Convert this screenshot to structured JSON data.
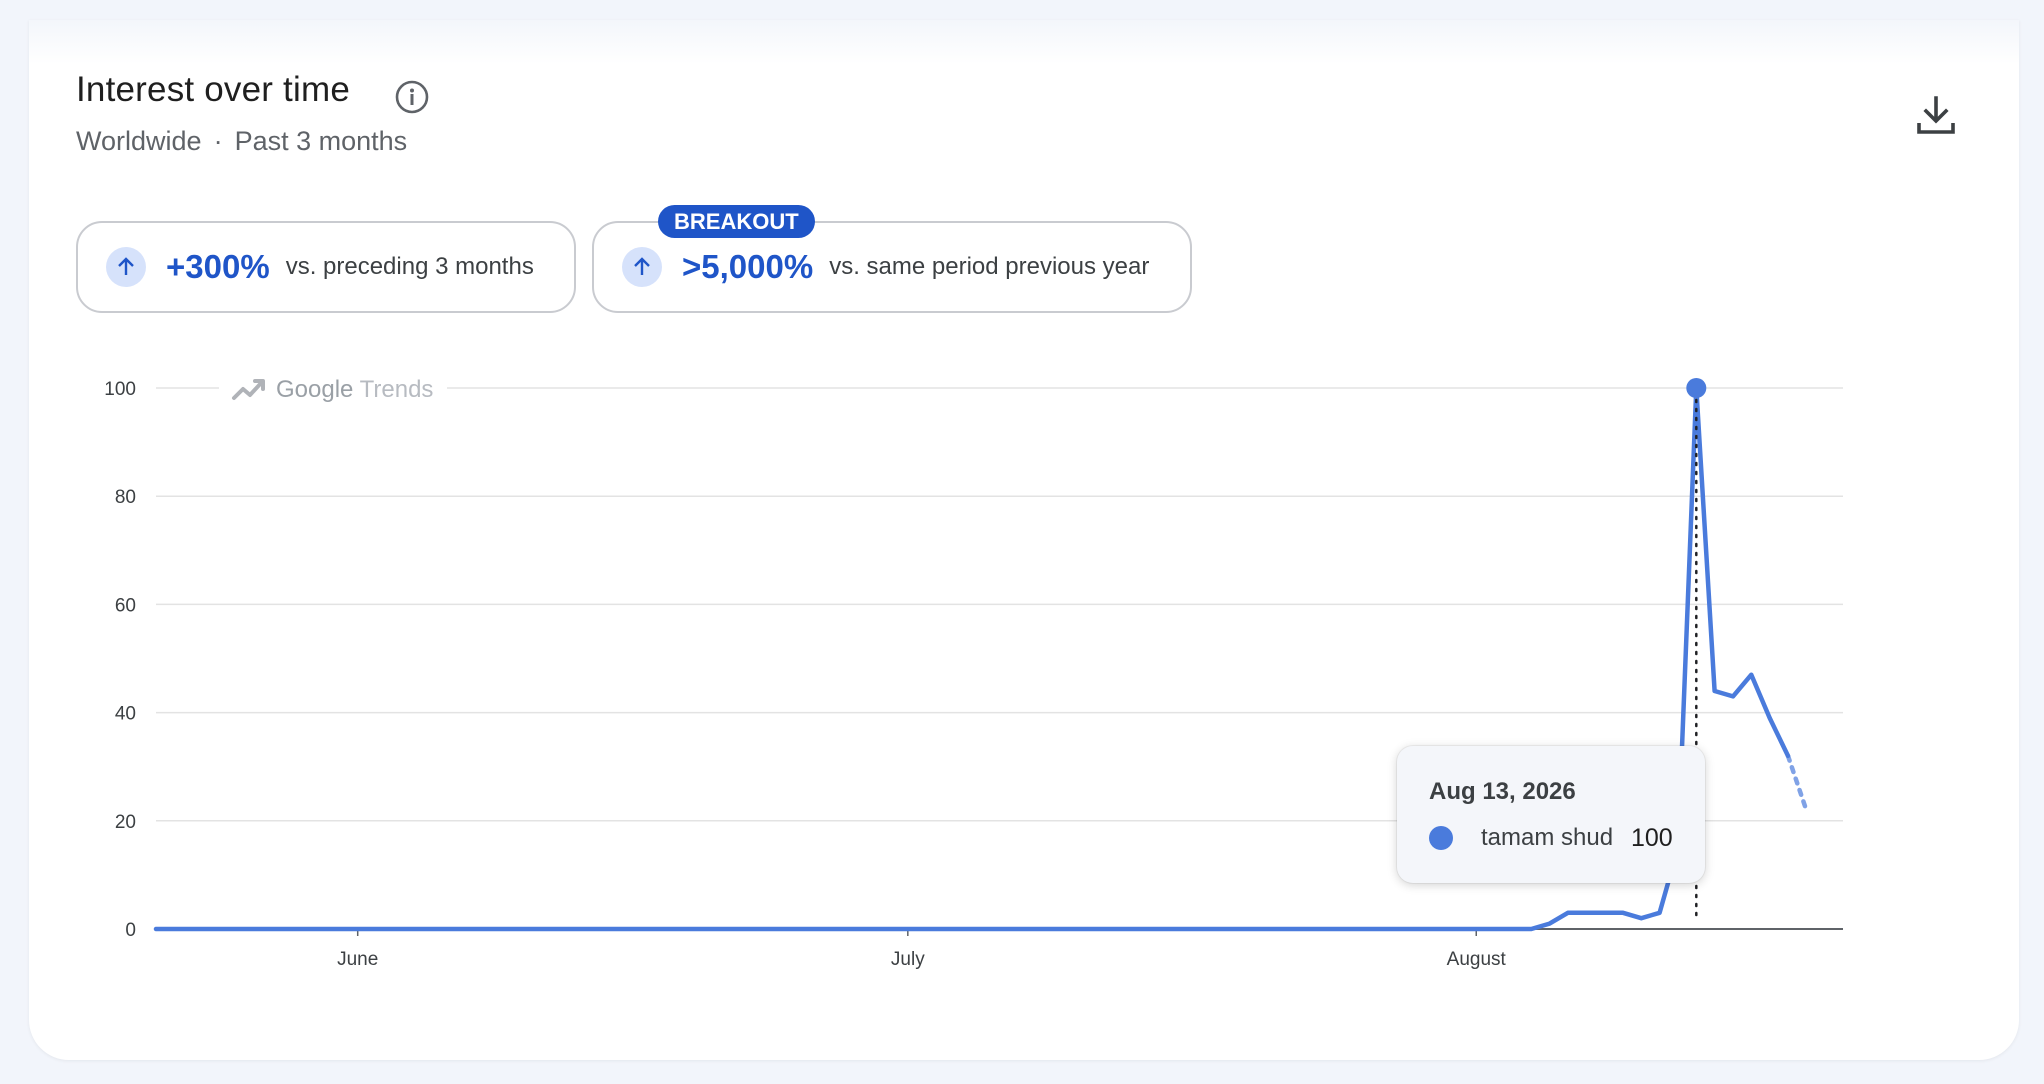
{
  "header": {
    "title": "Interest over time",
    "location": "Worldwide",
    "separator": "·",
    "period": "Past 3 months"
  },
  "stats": [
    {
      "value": "+300%",
      "label": "vs. preceding 3 months"
    },
    {
      "value": ">5,000%",
      "label": "vs. same period previous year",
      "badge": "BREAKOUT"
    }
  ],
  "watermark": {
    "text_a": "Google",
    "text_b": "Trends"
  },
  "tooltip": {
    "date": "Aug 13, 2026",
    "term": "tamam shud",
    "value": "100"
  },
  "colors": {
    "series": "#4a7bdc",
    "accent": "#1f55c8",
    "grid": "#e3e3e3"
  },
  "icons": {
    "info": "info-icon",
    "download": "download-icon",
    "up_arrow": "arrow-up-icon",
    "trend": "trending-up-icon"
  },
  "chart_data": {
    "type": "line",
    "x": [
      "May 21",
      "May 25",
      "Jun 1",
      "Jun 15",
      "Jul 1",
      "Jul 15",
      "Aug 1",
      "Aug 3",
      "Aug 4",
      "Aug 5",
      "Aug 6",
      "Aug 7",
      "Aug 8",
      "Aug 9",
      "Aug 10",
      "Aug 11",
      "Aug 12",
      "Aug 13",
      "Aug 14",
      "Aug 15",
      "Aug 16",
      "Aug 17",
      "Aug 18",
      "Aug 19",
      "Aug 20",
      "Aug 21"
    ],
    "x_start": "May 21",
    "x_end": "Aug 21",
    "series": [
      {
        "name": "tamam shud",
        "values": [
          0,
          0,
          0,
          0,
          0,
          0,
          0,
          0,
          0,
          1,
          3,
          3,
          3,
          3,
          2,
          3,
          15,
          100,
          44,
          43,
          47,
          39,
          32,
          22
        ],
        "x": [
          "May 21",
          "May 25",
          "Jun 1",
          "Jun 15",
          "Jul 1",
          "Jul 15",
          "Aug 1",
          "Aug 3",
          "Aug 4",
          "Aug 5",
          "Aug 6",
          "Aug 7",
          "Aug 8",
          "Aug 9",
          "Aug 10",
          "Aug 11",
          "Aug 12",
          "Aug 13",
          "Aug 14",
          "Aug 15",
          "Aug 16",
          "Aug 17",
          "Aug 18",
          "Aug 19"
        ]
      }
    ],
    "partial_from": "Aug 18",
    "xticks": [
      {
        "label": "June",
        "date": "Jun 1"
      },
      {
        "label": "July",
        "date": "Jul 1"
      },
      {
        "label": "August",
        "date": "Aug 1"
      }
    ],
    "yticks": [
      0,
      20,
      40,
      60,
      80,
      100
    ],
    "ylim": [
      0,
      100
    ],
    "highlight": {
      "date": "Aug 13",
      "value": 100
    },
    "grid": true
  }
}
